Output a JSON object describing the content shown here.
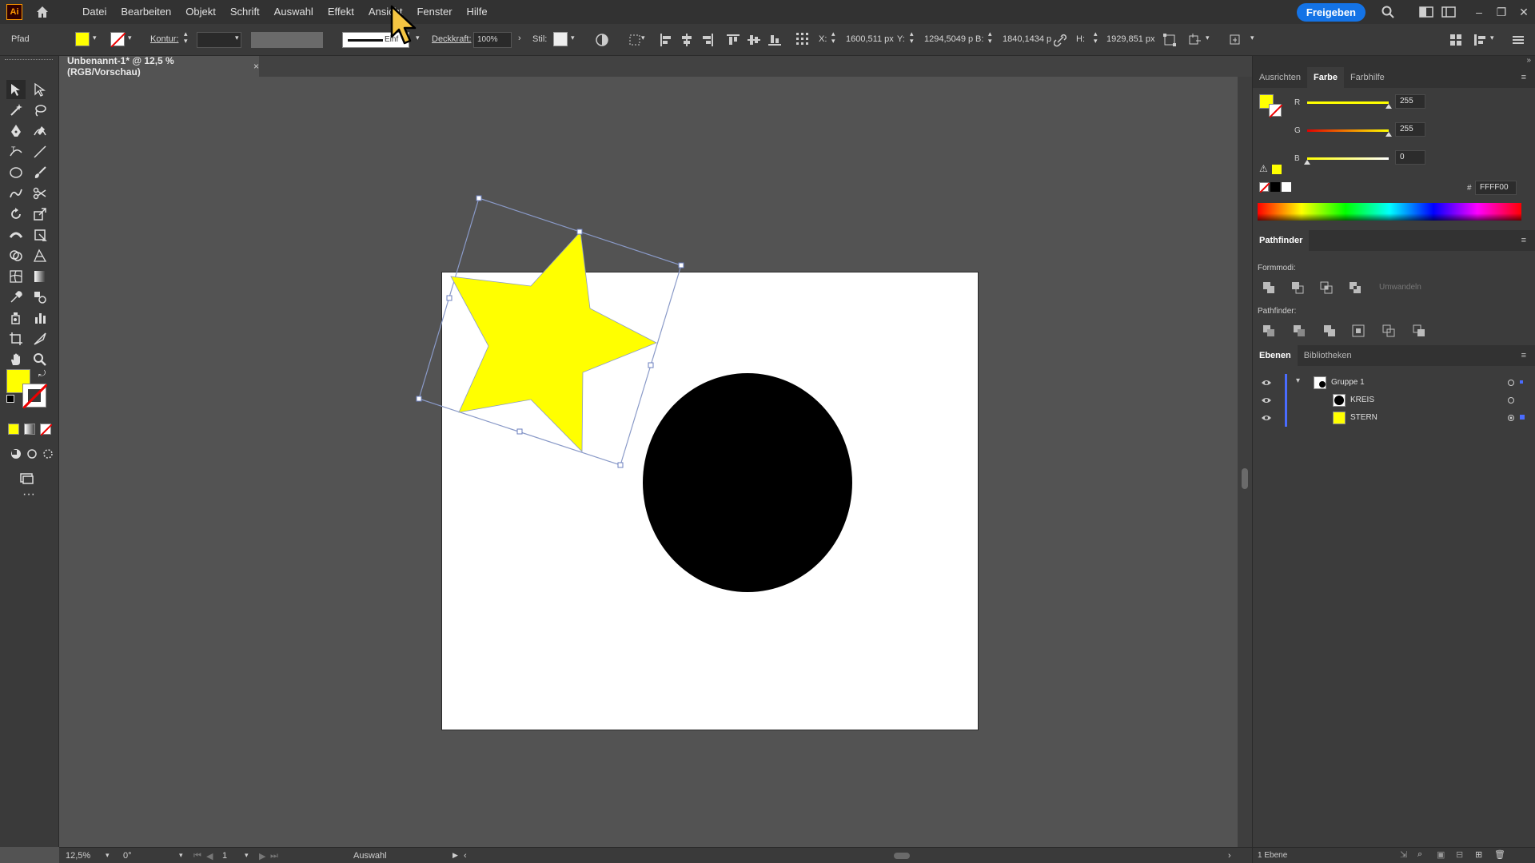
{
  "app": {
    "logo": "Ai",
    "home_icon": "home-icon"
  },
  "menu": [
    "Datei",
    "Bearbeiten",
    "Objekt",
    "Schrift",
    "Auswahl",
    "Effekt",
    "Ansicht",
    "Fenster",
    "Hilfe"
  ],
  "header_right": {
    "share": "Freigeben"
  },
  "controlbar": {
    "object_type": "Pfad",
    "stroke_label": "Kontur:",
    "opacity_label": "Deckkraft:",
    "opacity_value": "100%",
    "style_label": "Stil:",
    "x_label": "X:",
    "x_value": "1600,511 px",
    "y_label": "Y:",
    "y_value": "1294,5049 p",
    "w_label": "B:",
    "w_value": "1840,1434 p",
    "h_label": "H:",
    "h_value": "1929,851 px",
    "brush_label": "Einf"
  },
  "document": {
    "tab_title": "Unbenannt-1* @ 12,5 % (RGB/Vorschau)",
    "close": "×"
  },
  "colors": {
    "fill": "#FFFF00",
    "circle": "#000000",
    "accent": "#1473E6",
    "layer_accent": "#4A6CFF"
  },
  "color_panel": {
    "tabs": [
      "Ausrichten",
      "Farbe",
      "Farbhilfe"
    ],
    "active_tab": "Farbe",
    "r_label": "R",
    "r_value": "255",
    "r_level": 1.0,
    "g_label": "G",
    "g_value": "255",
    "g_level": 1.0,
    "b_label": "B",
    "b_value": "0",
    "b_level": 0.0,
    "hex_label": "#",
    "hex_value": "FFFF00"
  },
  "pathfinder": {
    "title": "Pathfinder",
    "shape_modes_label": "Formmodi:",
    "expand_label": "Umwandeln",
    "pathfinder_label": "Pathfinder:"
  },
  "layers_panel": {
    "tabs": [
      "Ebenen",
      "Bibliotheken"
    ],
    "active_tab": "Ebenen",
    "items": [
      {
        "name": "Gruppe 1",
        "level": 0,
        "swatch": "#FFFFFF"
      },
      {
        "name": "KREIS",
        "level": 1,
        "swatch": "#000000"
      },
      {
        "name": "STERN",
        "level": 1,
        "swatch": "#FFFF00"
      }
    ],
    "footer": "1 Ebene"
  },
  "statusbar": {
    "zoom": "12,5%",
    "rotation": "0°",
    "artboard": "1",
    "tool": "Auswahl"
  }
}
